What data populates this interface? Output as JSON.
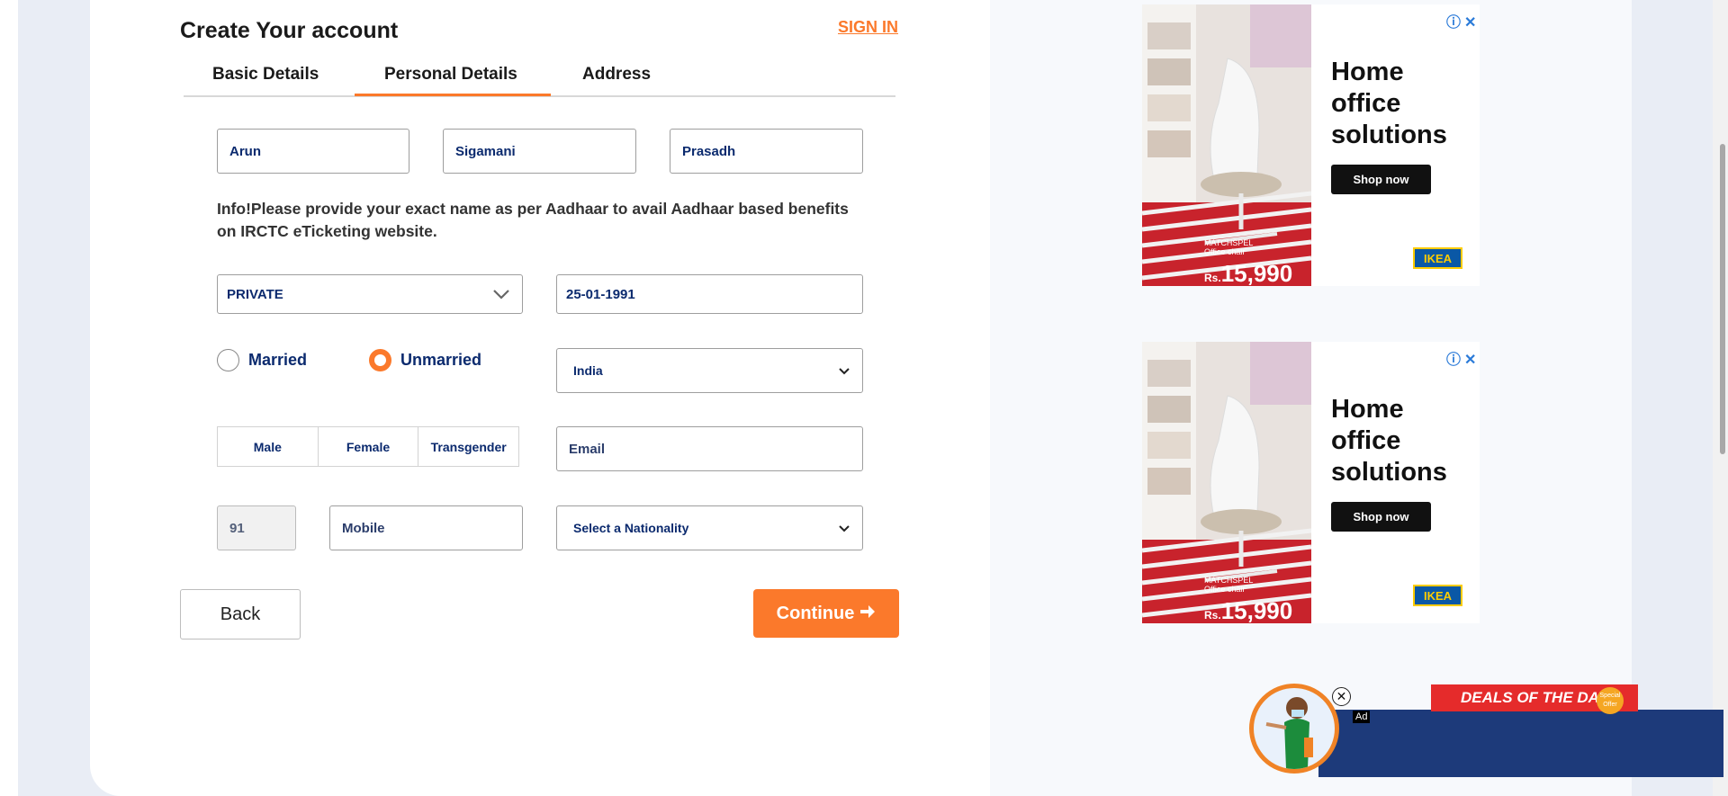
{
  "header": {
    "title": "Create Your account",
    "signin_label": "SIGN IN"
  },
  "tabs": [
    {
      "label": "Basic Details",
      "active": false
    },
    {
      "label": "Personal Details",
      "active": true
    },
    {
      "label": "Address",
      "active": false
    }
  ],
  "name": {
    "first": "Arun",
    "middle": "Sigamani",
    "last": "Prasadh"
  },
  "info_text": "Info!Please provide your exact name as per Aadhaar to avail Aadhaar based benefits on IRCTC eTicketing website.",
  "occupation": {
    "value": "PRIVATE"
  },
  "dob": {
    "value": "25-01-1991"
  },
  "marital_status": {
    "options": [
      "Married",
      "Unmarried"
    ],
    "selected": "Unmarried"
  },
  "country": {
    "value": "India"
  },
  "gender": {
    "options": [
      "Male",
      "Female",
      "Transgender"
    ]
  },
  "email": {
    "placeholder": "Email"
  },
  "mobile": {
    "country_code": "91",
    "placeholder": "Mobile"
  },
  "nationality": {
    "value": "Select a Nationality"
  },
  "actions": {
    "back_label": "Back",
    "continue_label": "Continue",
    "continue_icon": "arrow-right-icon"
  },
  "ads": [
    {
      "headline": "Home office solutions",
      "cta": "Shop now",
      "brand": "IKEA",
      "product_name": "MATCHSPEL",
      "product_desc": "Office chair",
      "price_currency": "Rs.",
      "price": "15,990",
      "icons": [
        "info-icon",
        "close-icon"
      ]
    },
    {
      "headline": "Home office solutions",
      "cta": "Shop now",
      "brand": "IKEA",
      "product_name": "MATCHSPEL",
      "product_desc": "Office chair",
      "price_currency": "Rs.",
      "price": "15,990",
      "icons": [
        "info-icon",
        "close-icon"
      ]
    }
  ],
  "deals": {
    "ribbon": "DEALS OF THE DAY",
    "badge": "Special Offer",
    "ad_tag": "Ad"
  },
  "colors": {
    "accent": "#fb792b",
    "text_blue": "#0b2a6e",
    "deals_bar": "#1d3a7a"
  }
}
